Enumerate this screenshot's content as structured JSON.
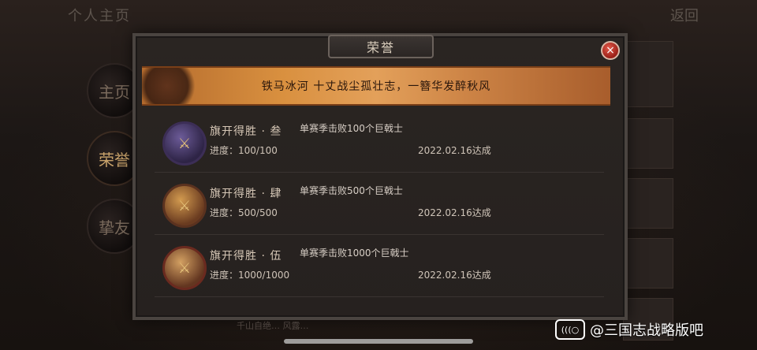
{
  "page": {
    "top_left_title": "个人主页",
    "top_right_back": "返回"
  },
  "side_menu": {
    "items": [
      {
        "label": "主页"
      },
      {
        "label": "荣誉"
      },
      {
        "label": "挚友"
      }
    ]
  },
  "dialog": {
    "title": "荣誉",
    "close_icon": "×",
    "banner_text": "铁马冰河  十丈战尘孤壮志，一簪华发醉秋风"
  },
  "achievements": [
    {
      "name": "旗开得胜 · 叁",
      "description": "单赛季击败100个巨戟士",
      "progress": "进度：100/100",
      "completed": "2022.02.16达成",
      "medal": "purple"
    },
    {
      "name": "旗开得胜 · 肆",
      "description": "单赛季击败500个巨戟士",
      "progress": "进度：500/500",
      "completed": "2022.02.16达成",
      "medal": "gold"
    },
    {
      "name": "旗开得胜 · 伍",
      "description": "单赛季击败1000个巨戟士",
      "progress": "进度：1000/1000",
      "completed": "2022.02.16达成",
      "medal": "gold2"
    }
  ],
  "footer": {
    "hint": "千山自绝… 风露… "
  },
  "watermark": {
    "icon_text": "(((○",
    "text": "@三国志战略版吧"
  }
}
